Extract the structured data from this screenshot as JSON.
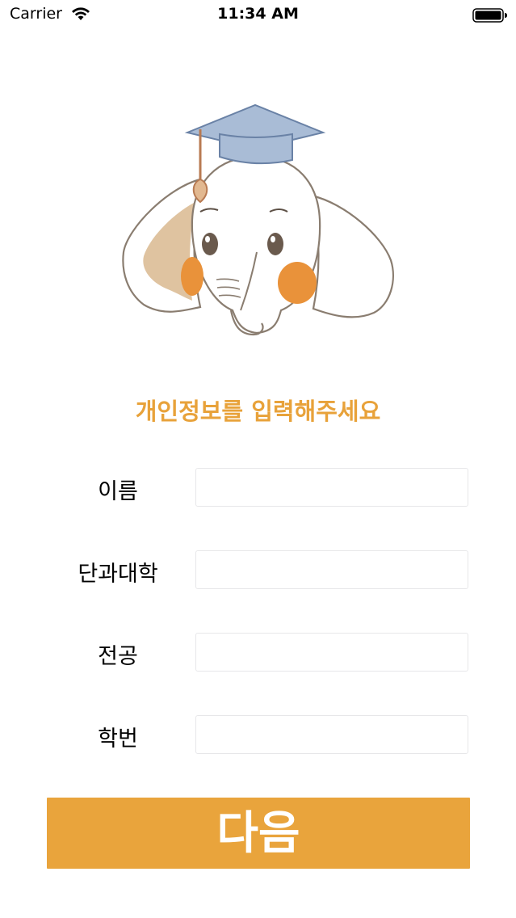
{
  "status_bar": {
    "carrier": "Carrier",
    "time": "11:34 AM"
  },
  "mascot": {
    "icon": "elephant-graduate-mascot"
  },
  "heading": "개인정보를 입력해주세요",
  "form": {
    "fields": [
      {
        "label": "이름",
        "value": ""
      },
      {
        "label": "단과대학",
        "value": ""
      },
      {
        "label": "전공",
        "value": ""
      },
      {
        "label": "학번",
        "value": ""
      }
    ]
  },
  "next_button": {
    "label": "다음"
  },
  "colors": {
    "accent": "#e9a43c",
    "heading": "#e8a23a",
    "cap": "#a9bcd6",
    "cheek": "#e9923a",
    "inner_ear": "#dfc3a0"
  }
}
